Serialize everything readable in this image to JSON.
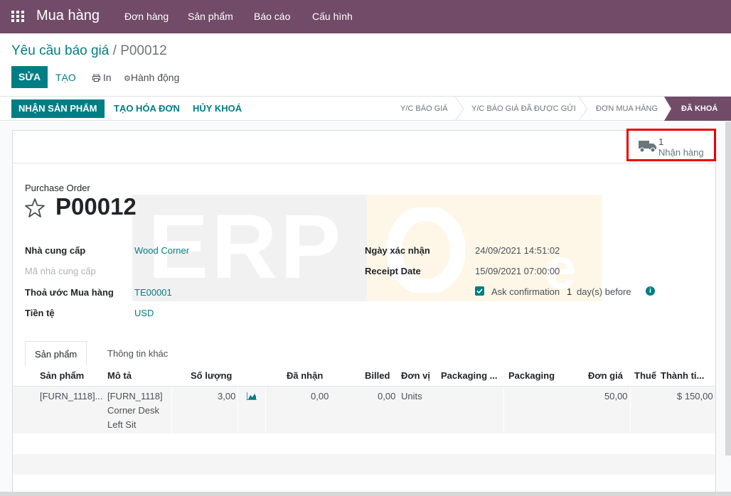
{
  "header": {
    "app_name": "Mua hàng",
    "menus": [
      "Đơn hàng",
      "Sản phẩm",
      "Báo cáo",
      "Cấu hình"
    ]
  },
  "breadcrumb": {
    "parent": "Yêu cầu báo giá",
    "separator": "/",
    "current": "P00012"
  },
  "toolbar": {
    "edit": "SỬA",
    "create": "TẠO",
    "print": "In",
    "action": "Hành động"
  },
  "statusbar": {
    "buttons": [
      "NHẬN SẢN PHẨM",
      "TẠO HÓA ĐƠN",
      "HỦY KHOÁ"
    ],
    "stages": [
      "Y/C BÁO GIÁ",
      "Y/C BÁO GIÁ ĐÃ ĐƯỢC GỬI",
      "ĐƠN MUA HÀNG",
      "ĐÃ KHOÁ"
    ],
    "active_stage": "ĐÃ KHOÁ"
  },
  "smart_button": {
    "count": "1",
    "label": "Nhận hàng",
    "icon": "truck-icon"
  },
  "form": {
    "label": "Purchase Order",
    "name": "P00012",
    "left": [
      {
        "label": "Nhà cung cấp",
        "value": "Wood Corner"
      },
      {
        "label": "Mã nhà cung cấp",
        "value": ""
      },
      {
        "label": "Thoả ước Mua hàng",
        "value": "TE00001"
      },
      {
        "label": "Tiền tệ",
        "value": "USD"
      }
    ],
    "right": [
      {
        "label": "Ngày xác nhận",
        "value": "24/09/2021 14:51:02"
      },
      {
        "label": "Receipt Date",
        "value": "15/09/2021 07:00:00"
      }
    ],
    "ask_confirmation": {
      "text": "Ask confirmation",
      "days": "1",
      "suffix": "day(s) before",
      "checked": true
    }
  },
  "tabs": [
    "Sản phẩm",
    "Thông tin khác"
  ],
  "table": {
    "columns": [
      "Sản phẩm",
      "Mô tả",
      "Số lượng",
      "Đã nhận",
      "Billed",
      "Đơn vị",
      "Packaging ...",
      "Packaging",
      "Đơn giá",
      "Thuế",
      "Thành ti..."
    ],
    "rows": [
      {
        "product": "[FURN_1118]...",
        "desc1": "[FURN_1118]",
        "desc2": "Corner Desk",
        "desc3": "Left Sit",
        "qty": "3,00",
        "received": "0,00",
        "billed": "0,00",
        "uom": "Units",
        "price": "50,00",
        "subtotal": "$ 150,00"
      }
    ]
  },
  "colors": {
    "primary": "#714b67",
    "accent": "#017e84",
    "highlight": "#e00000"
  }
}
